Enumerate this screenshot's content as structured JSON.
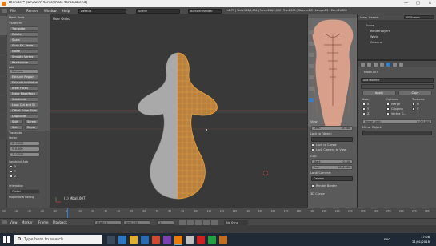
{
  "window": {
    "title": "Blender* [D:\\22 m torso\\male torso\\sbend]",
    "min": "—",
    "max": "□",
    "close": "✕"
  },
  "infobar": {
    "menus": [
      "File",
      "Render",
      "Window",
      "Help"
    ],
    "layout": "Default",
    "scene": "Scene",
    "engine": "Blender Render",
    "stats": "v2.79 | Verts:286/2,004 | Faces:284/2,000 | Tris:4,000 | Objects:1/5 | Lamps:0/1 | Mem:24.85M"
  },
  "toolshelf": {
    "tabs": [
      "Tools",
      "Create",
      "Relations",
      "Shading",
      "Options",
      "Grease Pencil"
    ],
    "header": "Mesh Tools",
    "transform_title": "Transform:",
    "transform": [
      "Translate",
      "Rotate",
      "Scale",
      "Slide Ed. Verte",
      "Noise",
      "Smooth Vertex",
      "Randomize"
    ],
    "add_title": "Add:",
    "add": [
      "Extrude",
      "Extrude Region",
      "Extrude Individual",
      "Inset Faces",
      "Make Edge/Face",
      "Subdivide",
      "Loop Cut and Sli",
      "Offset Edge Slide",
      "Duplicate"
    ],
    "split": "Split",
    "screw": "Screw",
    "spin": "Spin",
    "separate": "Separ",
    "op_title": "Translate",
    "vector_label": "Vector",
    "vector": [
      "X: 0.000",
      "Y: 0.000",
      "Z: 0.000"
    ],
    "constraint_label": "Constraint Axis",
    "axes": [
      "X",
      "Y",
      "Z"
    ],
    "orientation_label": "Orientation",
    "orientation": "Global",
    "prop_edit": "Proportional Editing"
  },
  "viewport": {
    "view_label": "User Ortho",
    "object_label": "(1) Mball.007"
  },
  "npanel": {
    "view_title": "View",
    "lens_label": "Lens:",
    "lens": "35.000",
    "lock_label": "Lock to Object:",
    "lock_cursor": "Lock to Cursor",
    "lock_camera": "Lock Camera to View",
    "clip_label": "Clip:",
    "clip_start": "Start:",
    "clip_start_v": "0.100",
    "clip_end": "End:",
    "clip_end_v": "1000.000",
    "local_camera": "Local Camera:",
    "camera": "Camera",
    "render_border": "Render Border",
    "cursor_title": "3D Cursor"
  },
  "outliner": {
    "view": "View",
    "search": "Search",
    "scope": "All Scenes",
    "items": [
      "Scene",
      "RenderLayers",
      "World",
      "Camera"
    ]
  },
  "properties": {
    "object": "Mball.007",
    "add_modifier": "Add Modifier",
    "apply": "Apply",
    "copy": "Copy",
    "axis_label": "Axis:",
    "options_label": "Options:",
    "textures_label": "Textures:",
    "axes": [
      "X",
      "Y",
      "Z"
    ],
    "options": [
      "Merge",
      "Clipping",
      "Vertex G..."
    ],
    "textures": [
      "U",
      "V"
    ],
    "merge_limit": "Merge Limit:",
    "merge_limit_v": "0.001000",
    "mirror_object": "Mirror Object:"
  },
  "timeline": {
    "ticks": [
      "-50",
      "-40",
      "-30",
      "-20",
      "-10",
      "0",
      "10",
      "20",
      "30",
      "40",
      "50",
      "60",
      "70",
      "80",
      "90",
      "100",
      "110",
      "120",
      "130",
      "140",
      "150",
      "160",
      "170",
      "180",
      "190",
      "200",
      "210",
      "220",
      "230",
      "240",
      "250",
      "260",
      "270",
      "280"
    ],
    "menus": [
      "View",
      "Marker",
      "Frame",
      "Playback"
    ],
    "start": "Start: 1",
    "end": "End: 250",
    "frame": "1",
    "sync": "No Sync"
  },
  "taskbar": {
    "search": "Type here to search",
    "time": "17:08",
    "date": "21/01/2018",
    "lang": "ENG"
  },
  "colors": {
    "accent": "#e87d0d",
    "viewport_bg": "#393939",
    "mesh_grey": "#a8a8a8",
    "wire_orange": "#f0a030"
  }
}
